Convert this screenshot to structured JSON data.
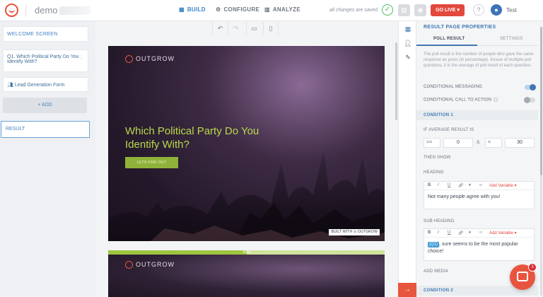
{
  "header": {
    "app_name": "demo",
    "nav": [
      {
        "label": "BUILD",
        "icon": "grid-icon"
      },
      {
        "label": "CONFIGURE",
        "icon": "gear-icon"
      },
      {
        "label": "ANALYZE",
        "icon": "bar-chart-icon"
      }
    ],
    "saved_text": "all changes are saved",
    "go_live_label": "GO LIVE ▾",
    "help_label": "?",
    "user_name": "Test"
  },
  "sidebar": {
    "items": [
      {
        "label": "WELCOME SCREEN"
      },
      {
        "label": "Q1. Which Political Party Do You Identify With?"
      },
      {
        "label": "Lead Generation Form"
      }
    ],
    "add_label": "+ ADD",
    "result_label": "RESULT"
  },
  "canvas": {
    "logo_text": "OUTGROW",
    "title": "Which Political Party Do You Identify With?",
    "cta_label": "LETS FIND OUT",
    "badge": "BUILT WITH ⊙ OUTGROW",
    "progress_label": "50%",
    "progress_value": 0.5,
    "logo_text_2": "OUTGROW"
  },
  "panel": {
    "title": "RESULT PAGE PROPERTIES",
    "tabs": [
      "POLL RESULT",
      "SETTINGS"
    ],
    "description": "The poll result is the number of people who gave the same response as yours (in percentage). Incase of multiple poll questions, it is the average of poll result of each question.",
    "conditional_messaging": "CONDITIONAL MESSAGING",
    "conditional_messaging_on": true,
    "conditional_cta": "CONDITIONAL CALL TO ACTION",
    "conditional_cta_on": false,
    "condition1": {
      "label": "CONDITION 1",
      "if_label": "IF AVERAGE RESULT IS",
      "op1": ">=",
      "val1": "0",
      "amp": "&",
      "op2": "<",
      "val2": "30",
      "then_label": "THEN SHOW",
      "heading_label": "HEADING",
      "heading_text": "Not many people agree with you!",
      "subheading_label": "SUB HEADING",
      "subheading_tag": "{Q1}",
      "subheading_text": ", sure seems to be the most popular choice!",
      "add_media": "ADD MEDIA"
    },
    "condition2_label": "CONDITION 2",
    "toolbar": {
      "b": "B",
      "i": "I",
      "u": "U",
      "add_variable": "Add Variable ▾"
    }
  },
  "chat": {
    "badge": "3"
  },
  "colors": {
    "accent": "#3f77b3",
    "brand": "#e5533d",
    "cta_green": "#8fb33a",
    "title_green": "#b9d94a"
  }
}
